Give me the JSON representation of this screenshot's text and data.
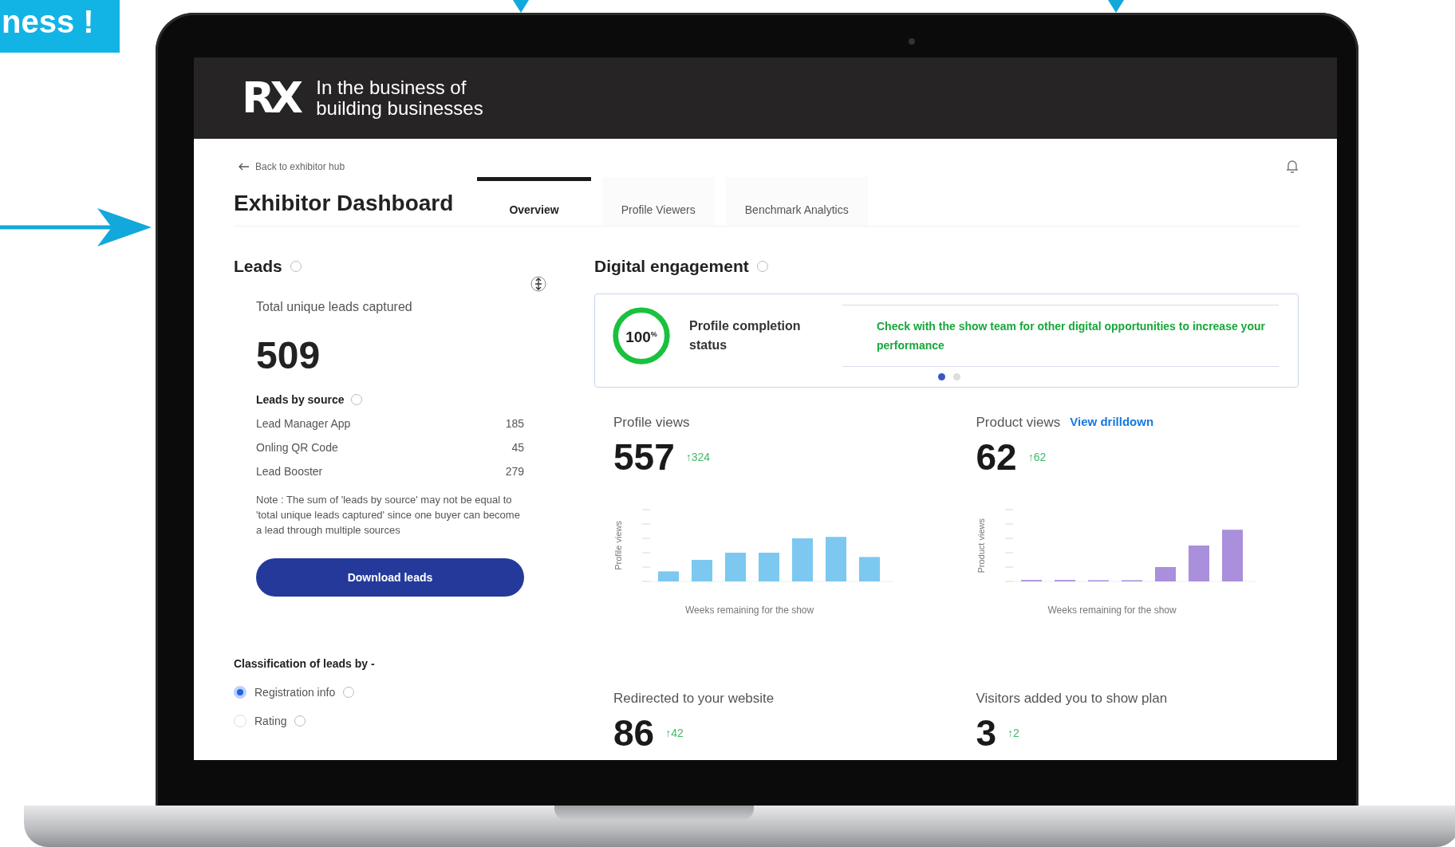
{
  "promo": {
    "banner": "ness !"
  },
  "header": {
    "logo": "RX",
    "tagline": [
      "In the business of",
      "building businesses"
    ]
  },
  "back_link": "Back to exhibitor hub",
  "title": "Exhibitor Dashboard",
  "tabs": [
    {
      "label": "Overview",
      "selected": true
    },
    {
      "label": "Profile Viewers",
      "selected": false
    },
    {
      "label": "Benchmark Analytics",
      "selected": false
    }
  ],
  "leads": {
    "title": "Leads",
    "total_label": "Total unique leads captured",
    "total": "509",
    "by_source_title": "Leads by source",
    "sources": [
      {
        "name": "Lead Manager App",
        "count": "185"
      },
      {
        "name": "Onling QR Code",
        "count": "45"
      },
      {
        "name": "Lead Booster",
        "count": "279"
      }
    ],
    "note": "Note : The sum of 'leads by source' may not be equal to 'total unique leads captured' since one buyer can become a lead through multiple sources",
    "download_button": "Download leads",
    "classification_title": "Classification of leads by -",
    "classification_options": [
      {
        "label": "Registration info",
        "selected": true
      },
      {
        "label": "Rating",
        "selected": false
      }
    ]
  },
  "engagement": {
    "title": "Digital engagement",
    "completion": {
      "percent": "100$^{%}$",
      "level": 1,
      "label": "Profile completion status"
    },
    "tip": "Check with the show team for other digital opportunities to increase your performance",
    "carousel_dots": [
      {
        "selected": true
      },
      {
        "selected": false
      }
    ],
    "metrics": [
      {
        "kind": "chart",
        "title": "Profile views",
        "value": "557",
        "delta": "↑324",
        "color": "#7cc8f0",
        "y_axis": "Profile views",
        "x_axis": "Weeks remaining for the show"
      },
      {
        "kind": "chart",
        "title": "Product views",
        "link": "View drilldown",
        "value": "62",
        "delta": "↑62",
        "color": "#a98fdc",
        "y_axis": "Product views",
        "x_axis": "Weeks remaining for the show"
      },
      {
        "kind": "plain",
        "title": "Redirected to your website",
        "value": "86",
        "delta": "↑42"
      },
      {
        "kind": "plain",
        "title": "Visitors added you to show plan",
        "value": "3",
        "delta": "↑2"
      }
    ]
  }
}
